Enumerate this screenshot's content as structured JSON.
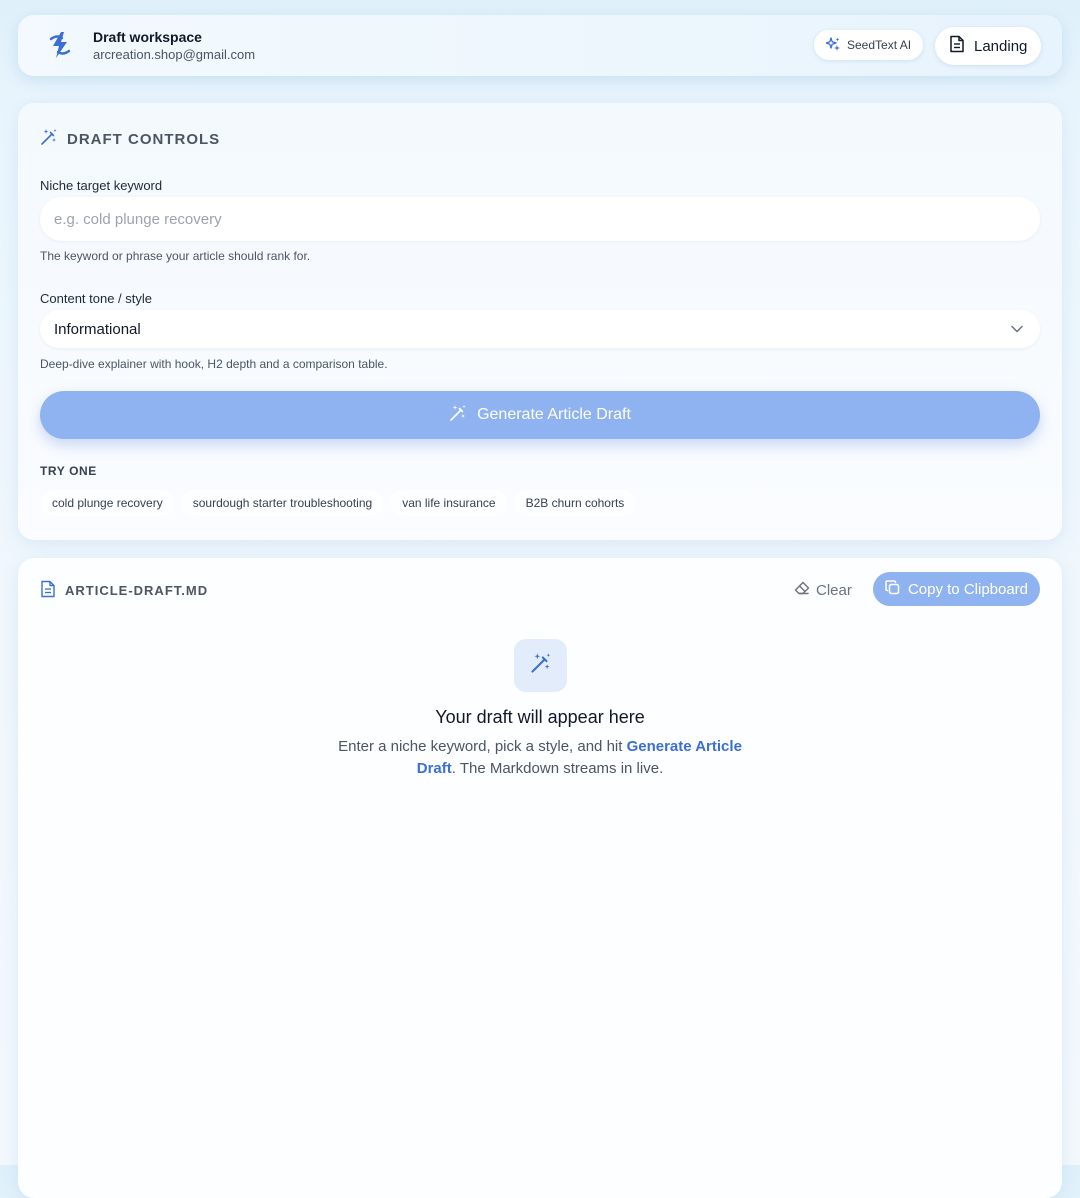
{
  "header": {
    "workspace_title": "Draft workspace",
    "email": "arcreation.shop@gmail.com",
    "model_chip": "SeedText AI",
    "landing_label": "Landing"
  },
  "controls": {
    "section_title": "DRAFT CONTROLS",
    "keyword": {
      "label": "Niche target keyword",
      "placeholder": "e.g. cold plunge recovery",
      "value": "",
      "helper": "The keyword or phrase your article should rank for."
    },
    "tone": {
      "label": "Content tone / style",
      "selected": "Informational",
      "helper": "Deep-dive explainer with hook, H2 depth and a comparison table."
    },
    "generate_label": "Generate Article Draft",
    "try_label": "TRY ONE",
    "suggestions": [
      "cold plunge recovery",
      "sourdough starter troubleshooting",
      "van life insurance",
      "B2B churn cohorts"
    ]
  },
  "draft": {
    "file_name": "ARTICLE-DRAFT.MD",
    "clear_label": "Clear",
    "copy_label": "Copy to Clipboard",
    "empty_title": "Your draft will appear here",
    "empty_desc_before": "Enter a niche keyword, pick a style, and hit ",
    "empty_desc_link": "Generate Article Draft",
    "empty_desc_after": ". The Markdown streams in live."
  },
  "colors": {
    "accent": "#3b6fd4",
    "button_fill": "#8fb2f0",
    "icon_tile": "#e2ecfb"
  },
  "icons": {
    "logo": "lightning-logo-icon",
    "seed": "sparkles-icon",
    "landing": "document-icon",
    "controls": "magic-wand-icon",
    "generate": "magic-wand-icon",
    "file": "document-icon",
    "clear": "eraser-icon",
    "copy": "copy-icon",
    "chevron": "chevron-down-icon"
  }
}
